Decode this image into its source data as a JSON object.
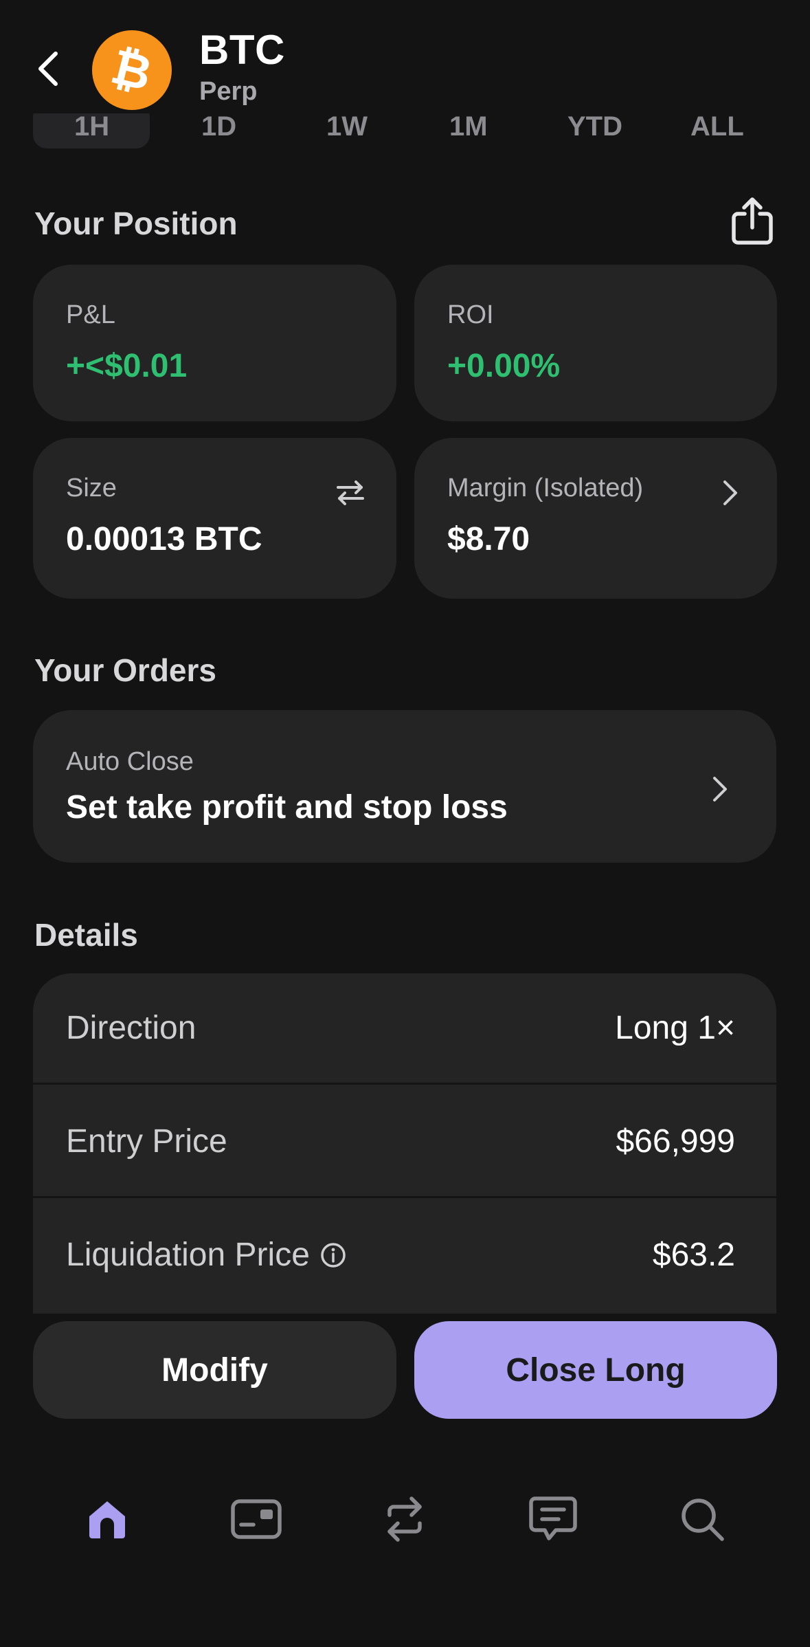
{
  "header": {
    "title": "BTC",
    "subtitle": "Perp",
    "coin_glyph": "₿"
  },
  "range_tabs": [
    "1H",
    "1D",
    "1W",
    "1M",
    "YTD",
    "ALL"
  ],
  "position": {
    "heading": "Your Position",
    "pnl": {
      "label": "P&L",
      "value": "+<$0.01"
    },
    "roi": {
      "label": "ROI",
      "value": "+0.00%"
    },
    "size": {
      "label": "Size",
      "value": "0.00013 BTC"
    },
    "margin": {
      "label": "Margin (Isolated)",
      "value": "$8.70"
    }
  },
  "orders": {
    "heading": "Your Orders",
    "auto_close": {
      "label": "Auto Close",
      "value": "Set take profit and stop loss"
    }
  },
  "details": {
    "heading": "Details",
    "rows": [
      {
        "label": "Direction",
        "value": "Long 1×"
      },
      {
        "label": "Entry Price",
        "value": "$66,999"
      },
      {
        "label": "Liquidation Price",
        "value": "$63.2"
      }
    ]
  },
  "actions": {
    "modify": "Modify",
    "close": "Close Long"
  },
  "nav": [
    "home-icon",
    "wallet-icon",
    "swap-icon",
    "chat-icon",
    "search-icon"
  ],
  "colors": {
    "background": "#131313",
    "card": "#242424",
    "positive": "#2fbf71",
    "accent": "#ab9ff2",
    "bitcoin": "#f7931a"
  }
}
